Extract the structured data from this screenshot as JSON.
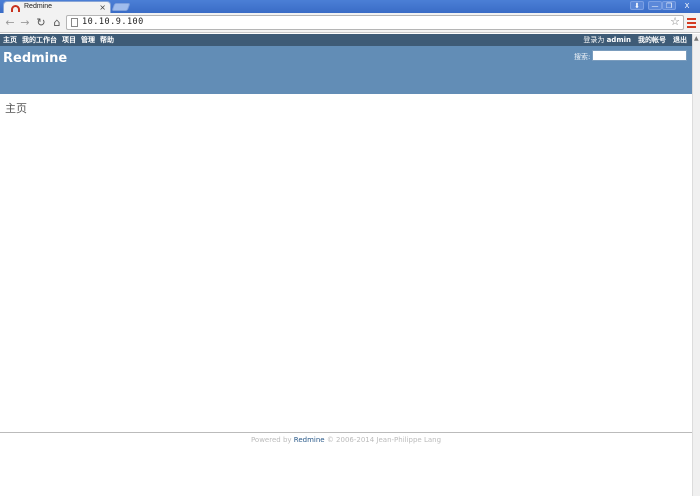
{
  "browser": {
    "tab_title": "Redmine",
    "tab_close": "×",
    "url": "10.10.9.100",
    "icons": {
      "back": "back-arrow-icon",
      "forward": "forward-arrow-icon",
      "reload": "reload-icon",
      "home": "home-icon",
      "star": "star-icon",
      "menu": "hamburger-menu-icon"
    },
    "window_controls": {
      "user": "⬇",
      "minimize": "—",
      "restore": "❐",
      "close": "X"
    }
  },
  "top_menu": {
    "left_items": [
      "主页",
      "我的工作台",
      "项目",
      "管理",
      "帮助"
    ],
    "logged_as_label": "登录为",
    "username": "admin",
    "my_account": "我的帐号",
    "logout": "退出"
  },
  "header": {
    "title": "Redmine",
    "search_label": "搜索:",
    "search_value": ""
  },
  "content": {
    "heading": "主页"
  },
  "footer": {
    "powered_by": "Powered by",
    "link": "Redmine",
    "copyright": "© 2006-2014 Jean-Philippe Lang"
  },
  "colors": {
    "top_menu_bg": "#3e5b76",
    "header_bg": "#628db6",
    "chrome_titlebar": "#3a6cc6",
    "link": "#2a5a8a"
  }
}
